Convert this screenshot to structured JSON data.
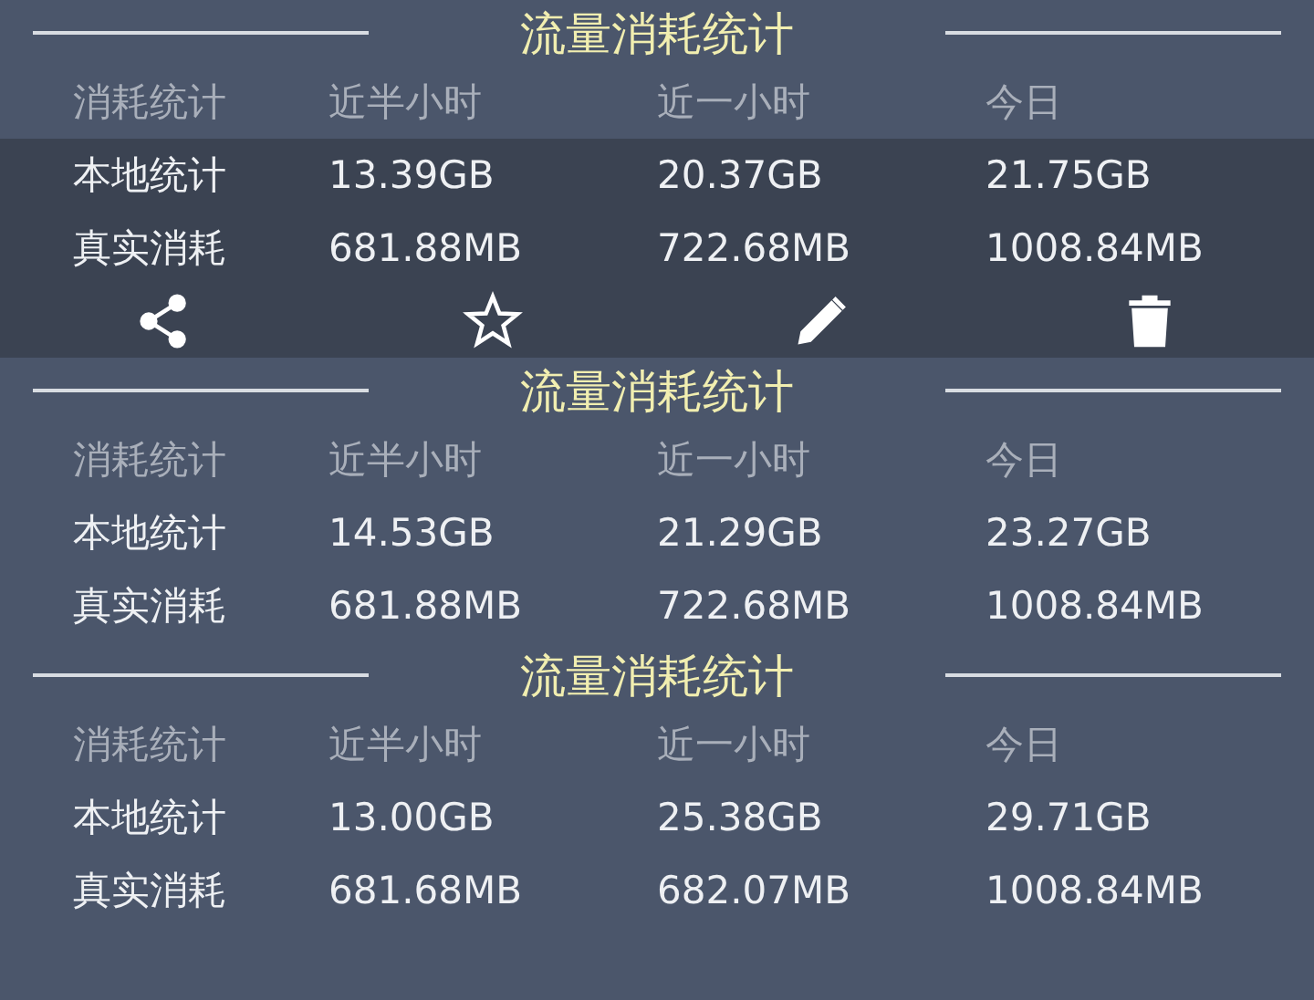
{
  "cards": [
    {
      "title": "流量消耗统计",
      "selected": true,
      "headers": [
        "消耗统计",
        "近半小时",
        "近一小时",
        "今日"
      ],
      "rows": [
        {
          "label": "本地统计",
          "values": [
            "13.39GB",
            "20.37GB",
            "21.75GB"
          ]
        },
        {
          "label": "真实消耗",
          "values": [
            "681.88MB",
            "722.68MB",
            "1008.84MB"
          ]
        }
      ]
    },
    {
      "title": "流量消耗统计",
      "selected": false,
      "headers": [
        "消耗统计",
        "近半小时",
        "近一小时",
        "今日"
      ],
      "rows": [
        {
          "label": "本地统计",
          "values": [
            "14.53GB",
            "21.29GB",
            "23.27GB"
          ]
        },
        {
          "label": "真实消耗",
          "values": [
            "681.88MB",
            "722.68MB",
            "1008.84MB"
          ]
        }
      ]
    },
    {
      "title": "流量消耗统计",
      "selected": false,
      "headers": [
        "消耗统计",
        "近半小时",
        "近一小时",
        "今日"
      ],
      "rows": [
        {
          "label": "本地统计",
          "values": [
            "13.00GB",
            "25.38GB",
            "29.71GB"
          ]
        },
        {
          "label": "真实消耗",
          "values": [
            "681.68MB",
            "682.07MB",
            "1008.84MB"
          ]
        }
      ]
    }
  ]
}
